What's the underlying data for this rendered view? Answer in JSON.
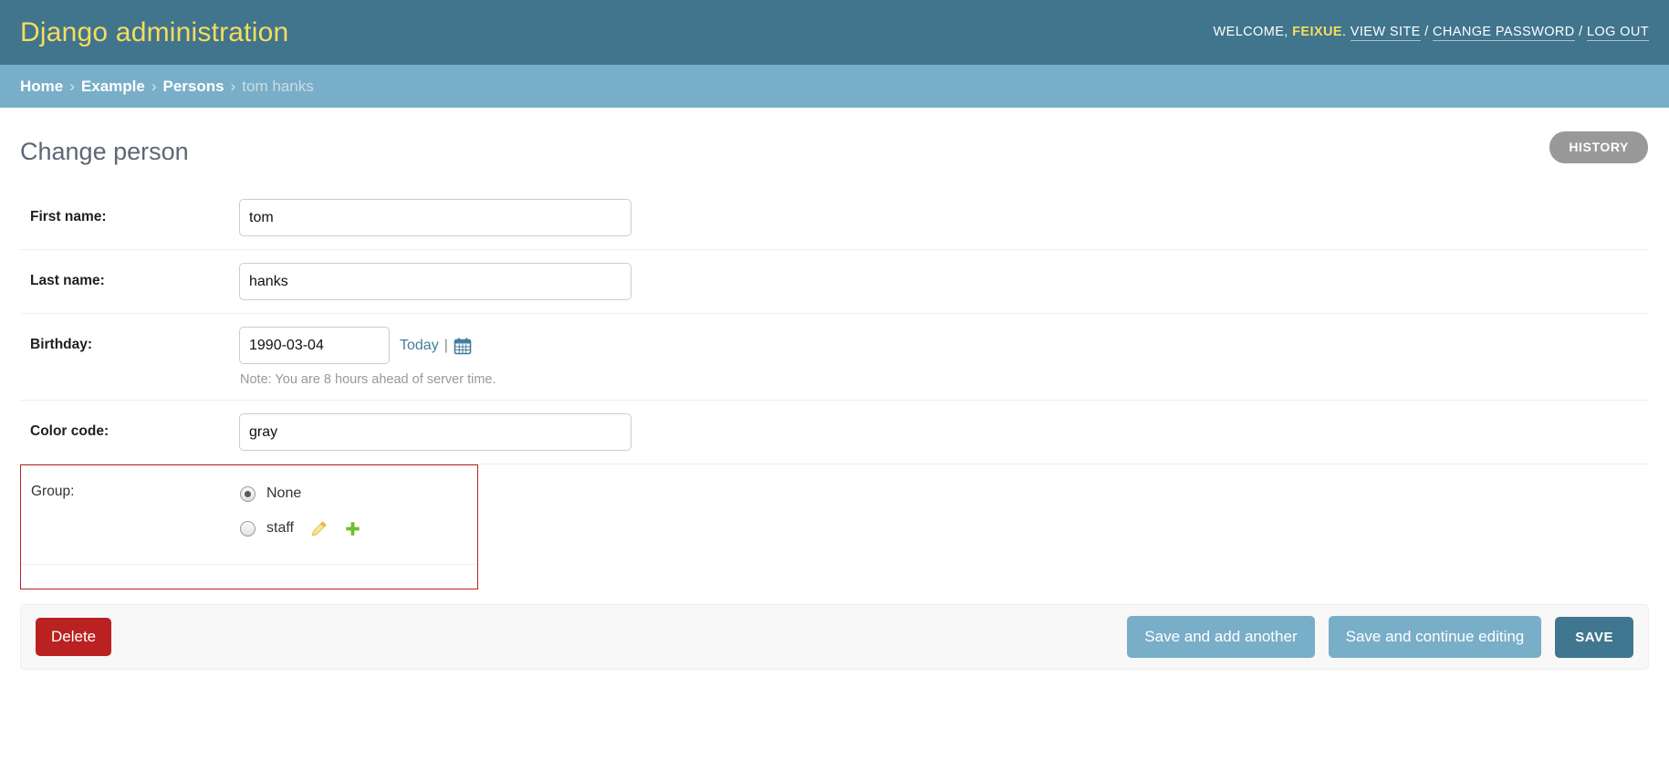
{
  "header": {
    "site_title": "Django administration",
    "welcome_label": "WELCOME,",
    "username": "FEIXUE",
    "period": ".",
    "view_site": "VIEW SITE",
    "sep1": "/",
    "change_password": "CHANGE PASSWORD",
    "sep2": "/",
    "log_out": "LOG OUT",
    "brand_color": "#F5DD5D",
    "bg_color": "#41748D"
  },
  "breadcrumbs": {
    "items": [
      {
        "label": "Home",
        "current": false
      },
      {
        "label": "Example",
        "current": false
      },
      {
        "label": "Persons",
        "current": false
      },
      {
        "label": "tom hanks",
        "current": true
      }
    ],
    "separator": "›",
    "bg_color": "#79AEC8"
  },
  "content": {
    "page_title": "Change person",
    "history_button": "HISTORY"
  },
  "form": {
    "rows": [
      {
        "label": "First name:",
        "value": "tom",
        "placeholder": ""
      },
      {
        "label": "Last name:",
        "value": "hanks",
        "placeholder": ""
      },
      {
        "label": "Birthday:",
        "value": "1990-03-04",
        "placeholder": "",
        "today_link": "Today",
        "pipe": "|",
        "calendar_icon": "calendar-icon",
        "note": "Note: You are 8 hours ahead of server time."
      },
      {
        "label": "Color code:",
        "value": "gray",
        "placeholder": ""
      }
    ],
    "group_field": {
      "label": "Group:",
      "has_error": true,
      "error_border_color": "#ba2121",
      "options": [
        {
          "label": "None",
          "checked": true,
          "has_edit": false,
          "has_add": false
        },
        {
          "label": "staff",
          "checked": false,
          "has_edit": true,
          "has_add": true
        }
      ],
      "edit_icon": "pencil-icon",
      "add_icon": "plus-icon",
      "edit_icon_color": "#efb80b",
      "add_icon_color": "#70bf2b"
    }
  },
  "submit_row": {
    "delete_label": "Delete",
    "save_and_add_another": "Save and add another",
    "save_and_continue": "Save and continue editing",
    "save": "SAVE",
    "delete_color": "#ba2121",
    "save_color": "#417690",
    "light_button_color": "#79AEC8"
  }
}
